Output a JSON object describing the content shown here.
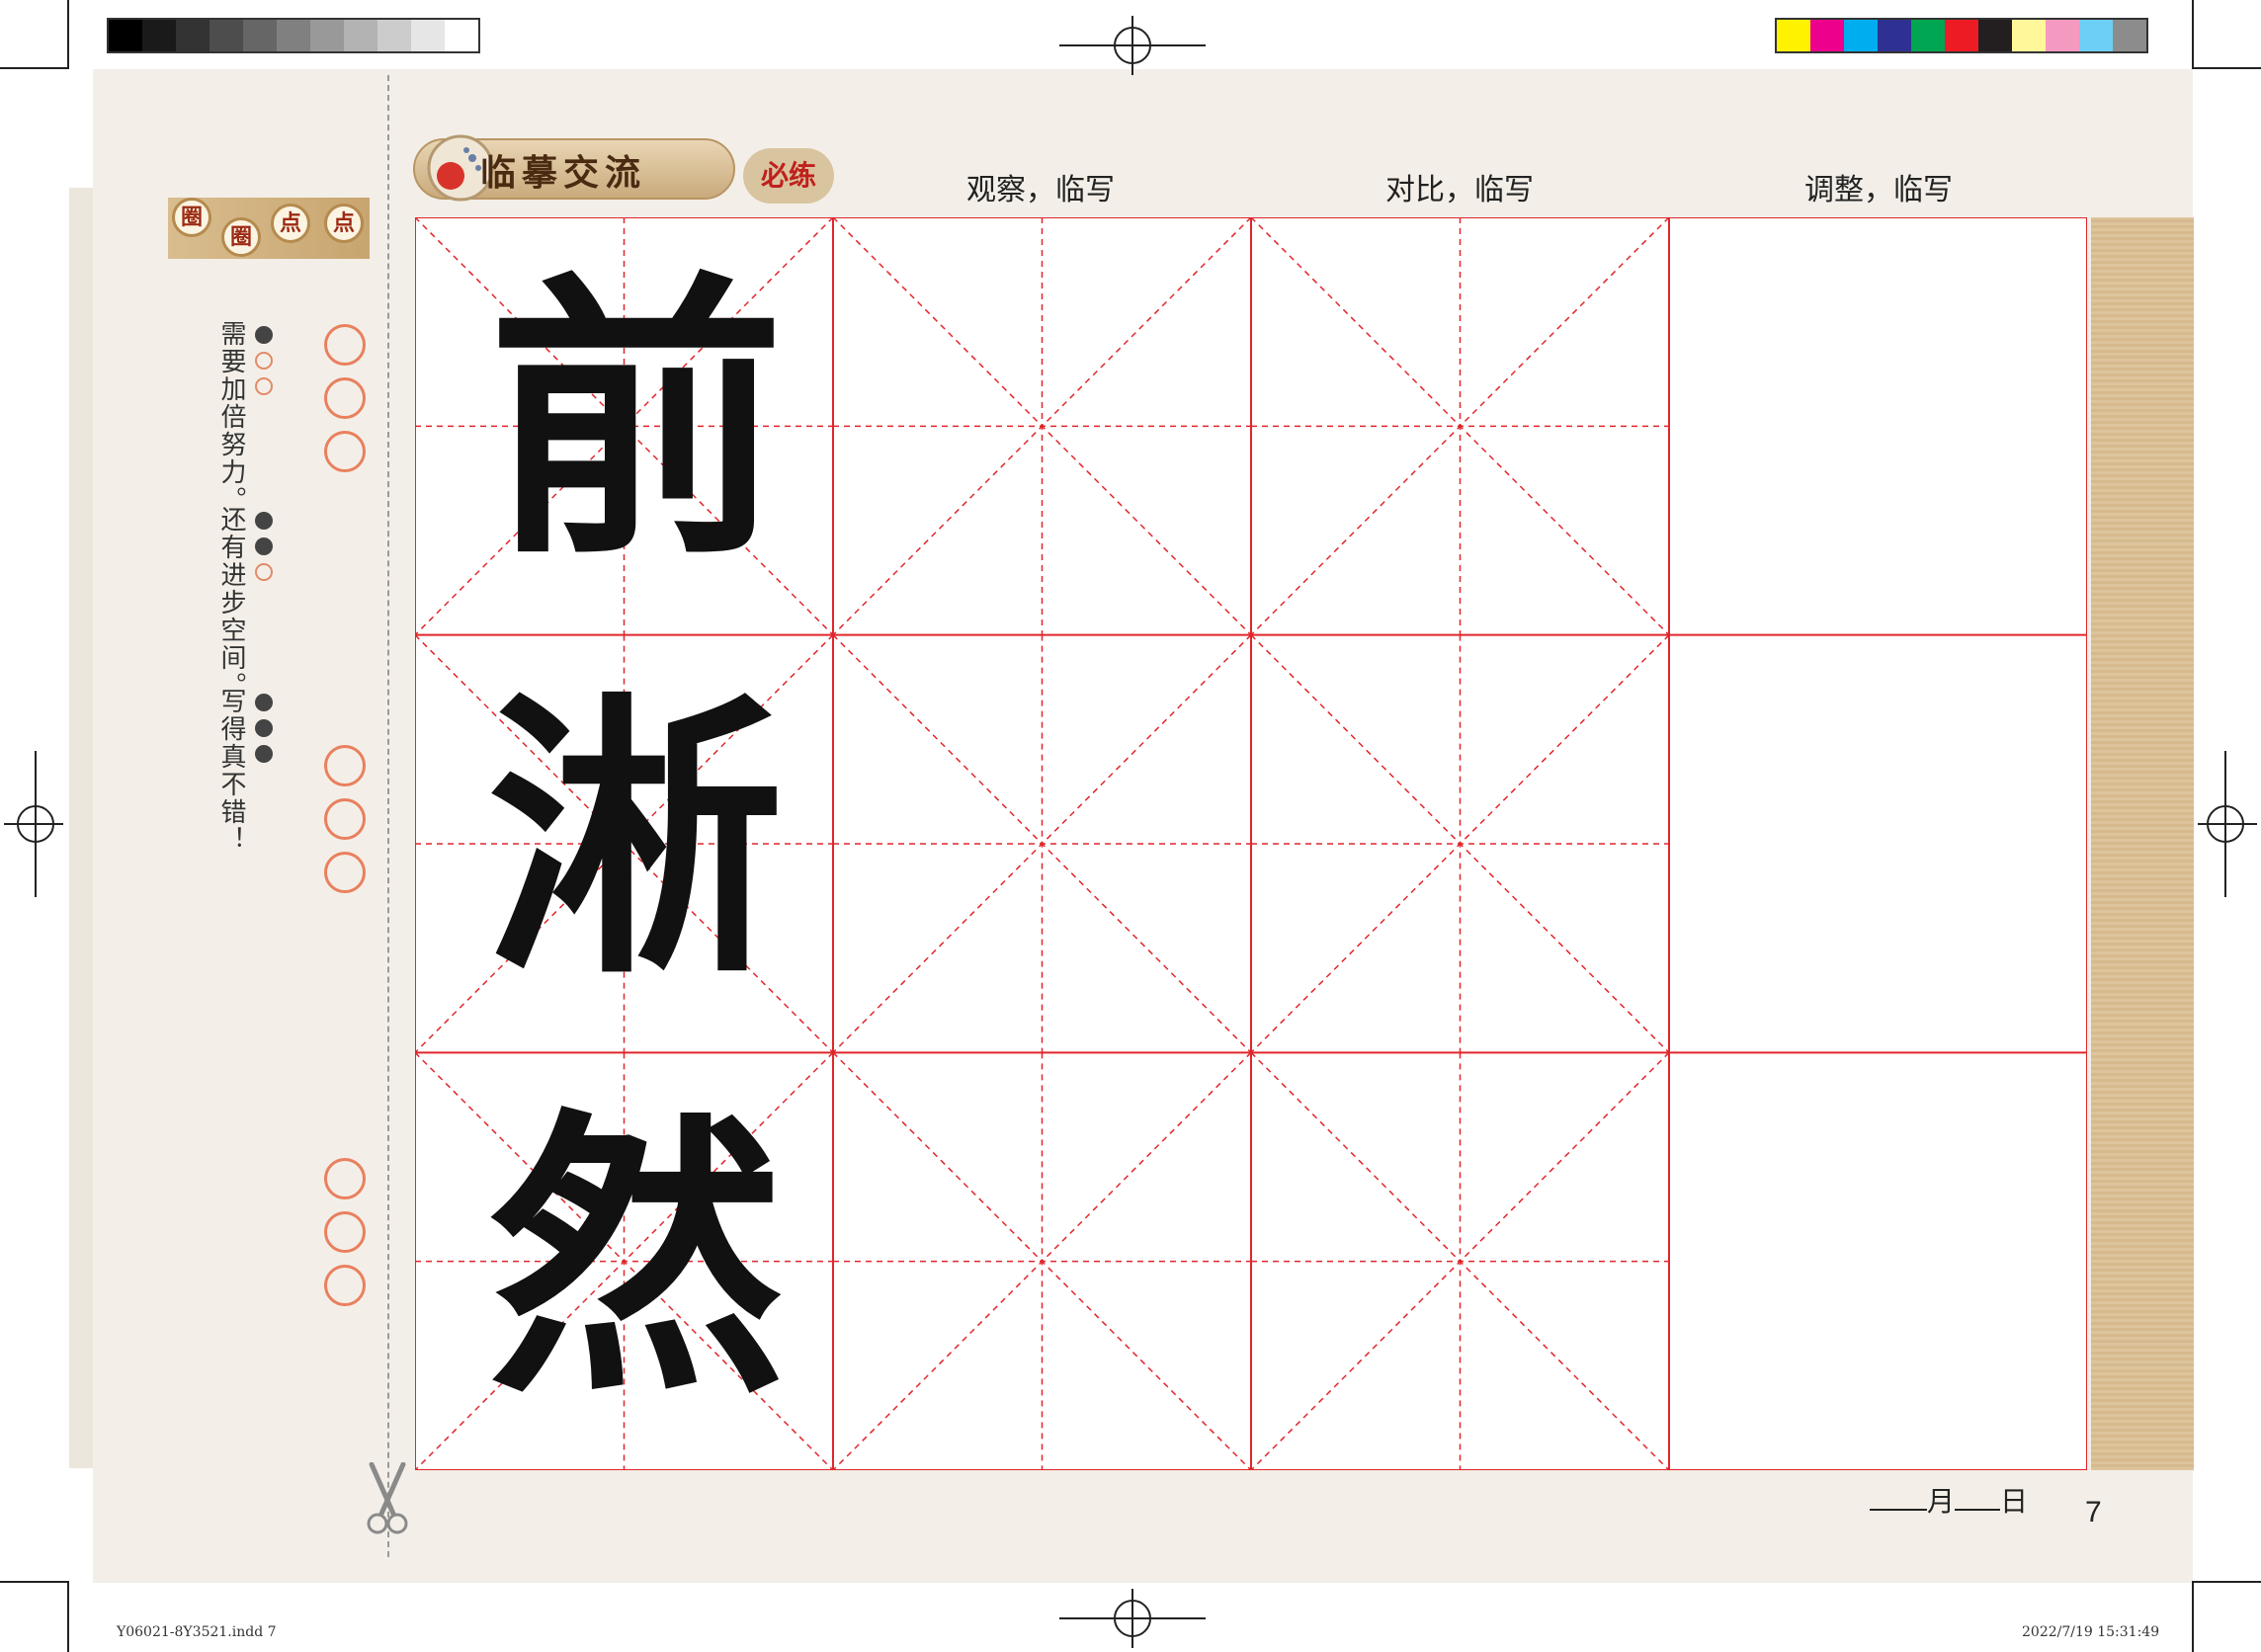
{
  "banner": {
    "title": "临摹交流",
    "badge": "必练"
  },
  "columns": [
    "观察，临写",
    "对比，临写",
    "调整，临写"
  ],
  "sidebar": {
    "title_chars": [
      "圈",
      "圈",
      "点",
      "点"
    ],
    "ratings": [
      {
        "text": "需要加倍努力。",
        "filled": 1
      },
      {
        "text": "还有进步空间。",
        "filled": 2
      },
      {
        "text": "写得真不错！",
        "filled": 3
      }
    ]
  },
  "characters": [
    "前",
    "淅",
    "然"
  ],
  "date": {
    "month_label": "月",
    "day_label": "日"
  },
  "page_number": "7",
  "footer": {
    "file": "Y06021-8Y3521.indd   7",
    "timestamp": "2022/7/19   15:31:49"
  },
  "colors": {
    "grid_red": "#e0262b",
    "grayscale_bar": [
      "#000000",
      "#1a1a1a",
      "#333333",
      "#4d4d4d",
      "#666666",
      "#808080",
      "#999999",
      "#b3b3b3",
      "#cccccc",
      "#e6e6e6",
      "#ffffff"
    ],
    "color_bar": [
      "#fff200",
      "#ec008c",
      "#00aeef",
      "#2e3192",
      "#00a651",
      "#ed1c24",
      "#231f20",
      "#fff799",
      "#f49ac1",
      "#6dcff6",
      "#8c8c8c"
    ]
  }
}
